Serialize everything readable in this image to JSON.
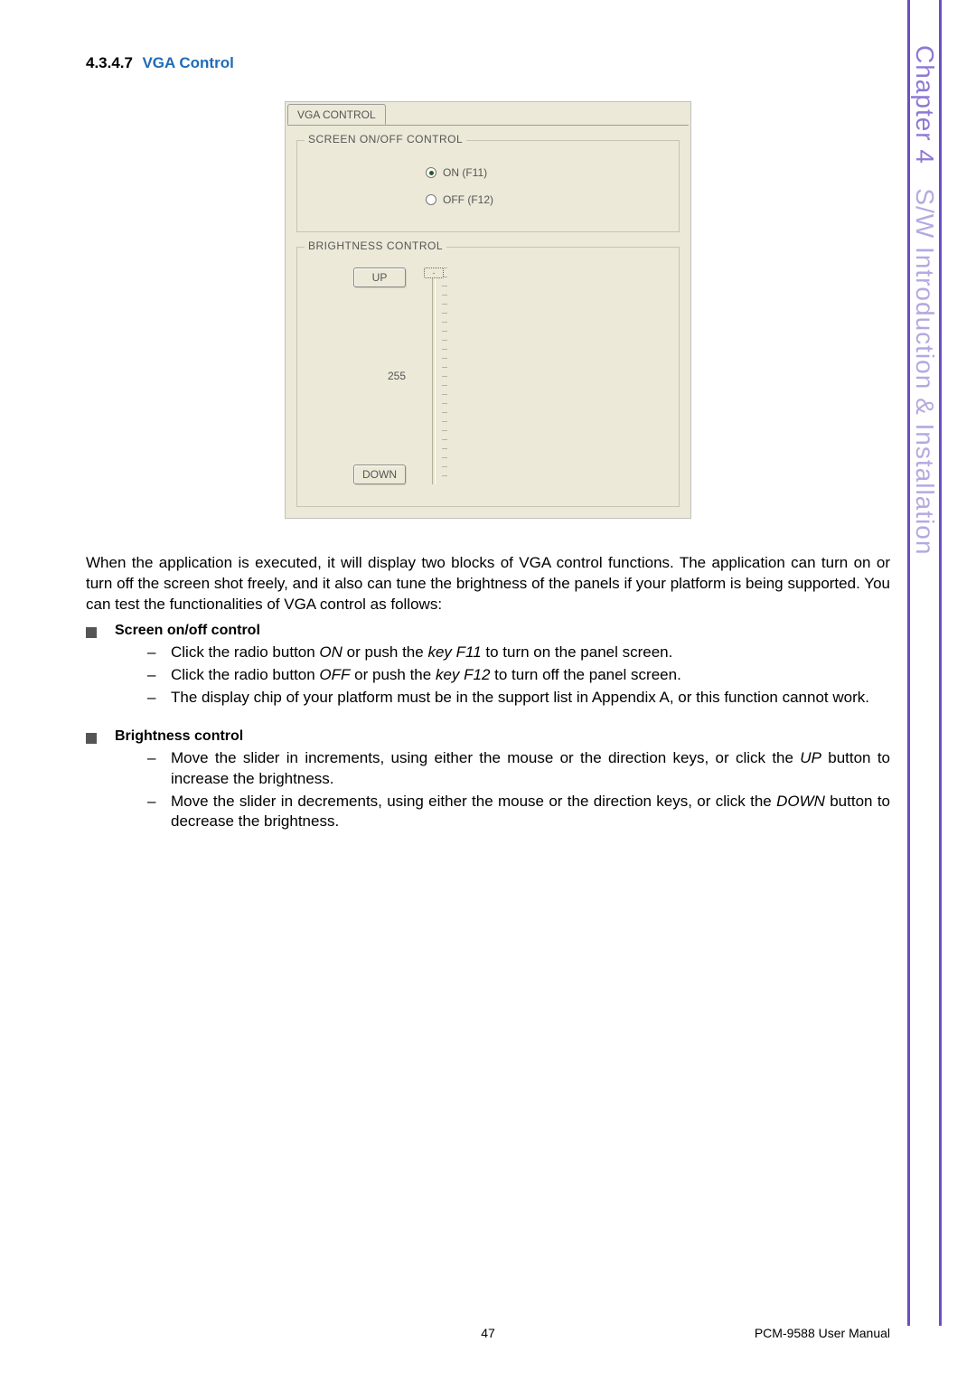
{
  "section": {
    "number": "4.3.4.7",
    "title": "VGA Control"
  },
  "vga_panel": {
    "tab_label": "VGA CONTROL",
    "group_screen": {
      "legend": "SCREEN ON/OFF CONTROL",
      "opt_on": "ON  (F11)",
      "opt_off": "OFF (F12)"
    },
    "group_brightness": {
      "legend": "BRIGHTNESS CONTROL",
      "btn_up": "UP",
      "btn_down": "DOWN",
      "value": "255"
    }
  },
  "paragraph": "When the application is executed, it will display two blocks of VGA control functions. The application can turn on or turn off the screen shot freely, and it also can tune the brightness of the panels if your platform is being supported. You can test the functionalities of VGA control as follows:",
  "bullets": {
    "screen": {
      "heading": "Screen on/off control",
      "item1_a": "Click the radio button ",
      "item1_b": "ON",
      "item1_c": " or push the ",
      "item1_d": "key F11",
      "item1_e": " to turn on the panel screen.",
      "item2_a": "Click the radio button ",
      "item2_b": "OFF",
      "item2_c": " or push the ",
      "item2_d": "key F12",
      "item2_e": " to turn off the panel screen.",
      "item3": "The display chip of your platform must be in the support list in Appendix A, or this function cannot work."
    },
    "brightness": {
      "heading": "Brightness control",
      "item1_a": "Move the slider in increments, using either the mouse or the direction keys, or click the ",
      "item1_b": "UP",
      "item1_c": " button to increase the brightness.",
      "item2_a": "Move the slider in decrements, using either the mouse or the direction keys, or click the ",
      "item2_b": "DOWN",
      "item2_c": " button to decrease the brightness."
    }
  },
  "side": {
    "chapter": "Chapter 4",
    "title": "S/W Introduction & Installation"
  },
  "footer": {
    "page": "47",
    "manual": "PCM-9588 User Manual"
  }
}
